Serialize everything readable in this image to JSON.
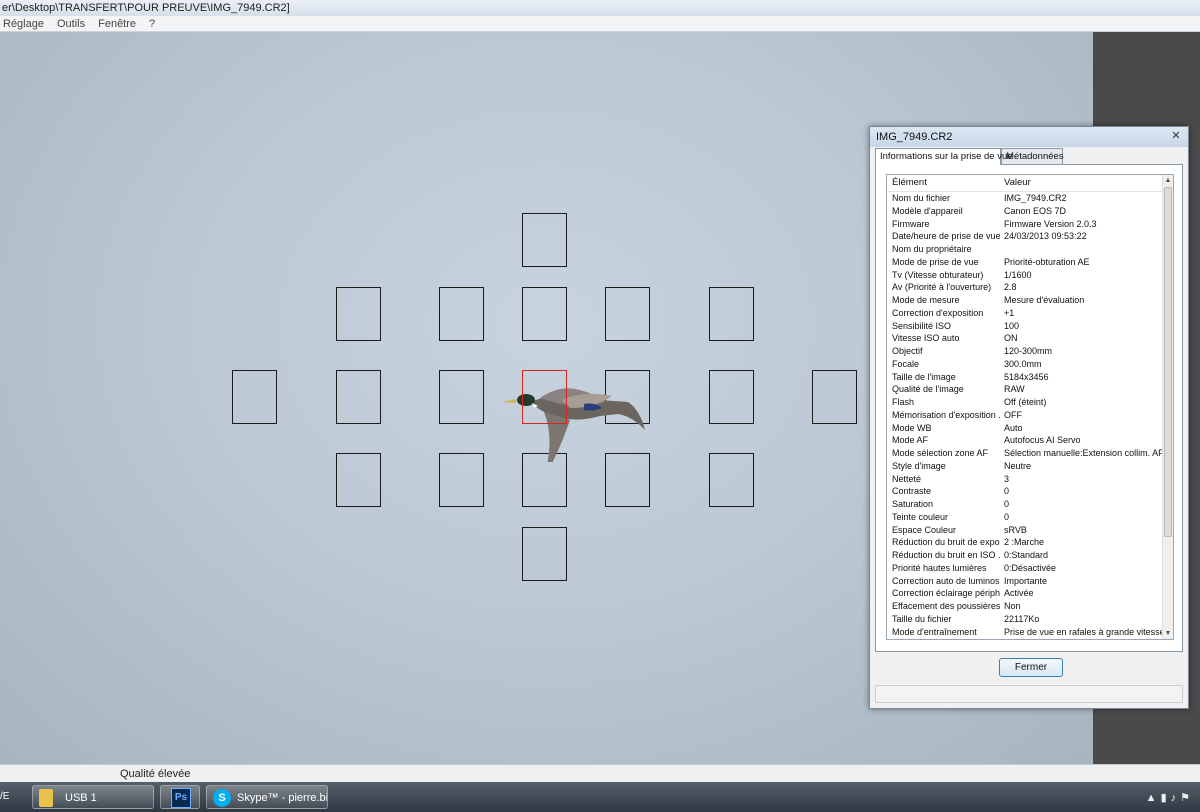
{
  "window": {
    "title": "er\\Desktop\\TRANSFERT\\POUR PREUVE\\IMG_7949.CR2]"
  },
  "menu": [
    "Réglage",
    "Outils",
    "Fenêtre",
    "?"
  ],
  "status_bar": {
    "text": "Qualité élevée"
  },
  "taskbar": {
    "start_fragment": "/E",
    "items": [
      {
        "label": "USB 1",
        "icon": "folder-icon"
      },
      {
        "label": "",
        "icon": "photoshop-icon",
        "icon_text": "Ps"
      },
      {
        "label": "Skype™ - pierre.bi...",
        "icon": "skype-icon",
        "icon_text": "S"
      }
    ]
  },
  "dialog": {
    "title": "IMG_7949.CR2",
    "tabs": [
      {
        "label": "Informations sur la prise de vue",
        "active": true
      },
      {
        "label": "Métadonnées",
        "active": false
      }
    ],
    "columns": [
      "Élément",
      "Valeur"
    ],
    "rows": [
      [
        "Nom du fichier",
        "IMG_7949.CR2"
      ],
      [
        "Modèle d'appareil",
        "Canon EOS 7D"
      ],
      [
        "Firmware",
        "Firmware Version 2.0.3"
      ],
      [
        "Date/heure de prise de vue",
        "24/03/2013 09:53:22"
      ],
      [
        "Nom du propriétaire",
        ""
      ],
      [
        "Mode de prise de vue",
        "Priorité-obturation AE"
      ],
      [
        "Tv (Vitesse obturateur)",
        "1/1600"
      ],
      [
        "Av (Priorité à l'ouverture)",
        "2.8"
      ],
      [
        "Mode de mesure",
        "Mesure d'évaluation"
      ],
      [
        "Correction d'exposition",
        "+1"
      ],
      [
        "Sensibilité ISO",
        "100"
      ],
      [
        "Vitesse ISO auto",
        "ON"
      ],
      [
        "Objectif",
        "120-300mm"
      ],
      [
        "Focale",
        "300.0mm"
      ],
      [
        "Taille de l'image",
        "5184x3456"
      ],
      [
        "Qualité de l'image",
        "RAW"
      ],
      [
        "Flash",
        "Off (éteint)"
      ],
      [
        "Mémorisation d'exposition ...",
        "OFF"
      ],
      [
        "Mode WB",
        "Auto"
      ],
      [
        "Mode AF",
        "Autofocus AI Servo"
      ],
      [
        "Mode sélection zone AF",
        "Sélection manuelle:Extension collim. AF"
      ],
      [
        "Style d'image",
        "Neutre"
      ],
      [
        "Netteté",
        "3"
      ],
      [
        "Contraste",
        "0"
      ],
      [
        "Saturation",
        "0"
      ],
      [
        "Teinte couleur",
        "0"
      ],
      [
        "Espace Couleur",
        "sRVB"
      ],
      [
        "Réduction du bruit de expo...",
        "2 :Marche"
      ],
      [
        "Réduction du bruit en ISO ...",
        "0:Standard"
      ],
      [
        "Priorité hautes lumières",
        "0:Désactivée"
      ],
      [
        "Correction auto de luminosité",
        "Importante"
      ],
      [
        "Correction éclairage périph...",
        "Activée"
      ],
      [
        "Effacement des poussières",
        "Non"
      ],
      [
        "Taille du fichier",
        "22117Ko"
      ],
      [
        "Mode d'entraînement",
        "Prise de vue en rafales à grande vitesse"
      ]
    ],
    "close_button": "Fermer"
  },
  "colors": {
    "af_point": "#1b1b1b",
    "af_point_selected": "#d8261f"
  }
}
